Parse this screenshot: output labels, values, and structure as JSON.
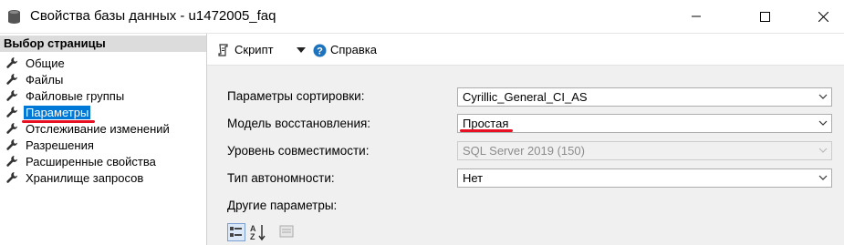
{
  "window": {
    "title": "Свойства базы данных - u1472005_faq",
    "icon": "database-icon",
    "controls": [
      "minimize-icon",
      "maximize-icon",
      "close-icon"
    ]
  },
  "sidebar": {
    "header": "Выбор страницы",
    "items": [
      {
        "label": "Общие",
        "icon": "wrench-icon"
      },
      {
        "label": "Файлы",
        "icon": "wrench-icon"
      },
      {
        "label": "Файловые группы",
        "icon": "wrench-icon"
      },
      {
        "label": "Параметры",
        "icon": "wrench-icon",
        "selected": true
      },
      {
        "label": "Отслеживание изменений",
        "icon": "wrench-icon"
      },
      {
        "label": "Разрешения",
        "icon": "wrench-icon"
      },
      {
        "label": "Расширенные свойства",
        "icon": "wrench-icon"
      },
      {
        "label": "Хранилище запросов",
        "icon": "wrench-icon"
      }
    ]
  },
  "toolbar": {
    "script_label": "Скрипт",
    "help_label": "Справка"
  },
  "form": {
    "collation": {
      "label": "Параметры сортировки:",
      "value": "Cyrillic_General_CI_AS"
    },
    "recovery_model": {
      "label": "Модель восстановления:",
      "value": "Простая"
    },
    "compat_level": {
      "label": "Уровень совместимости:",
      "value": "SQL Server 2019 (150)",
      "disabled": true
    },
    "containment": {
      "label": "Тип автономности:",
      "value": "Нет"
    },
    "other_options_label": "Другие параметры:"
  },
  "colors": {
    "selection": "#0078d7",
    "annotation_underline": "#e81123",
    "content_bg": "#f0f0f0",
    "help_icon": "#1e73be"
  }
}
